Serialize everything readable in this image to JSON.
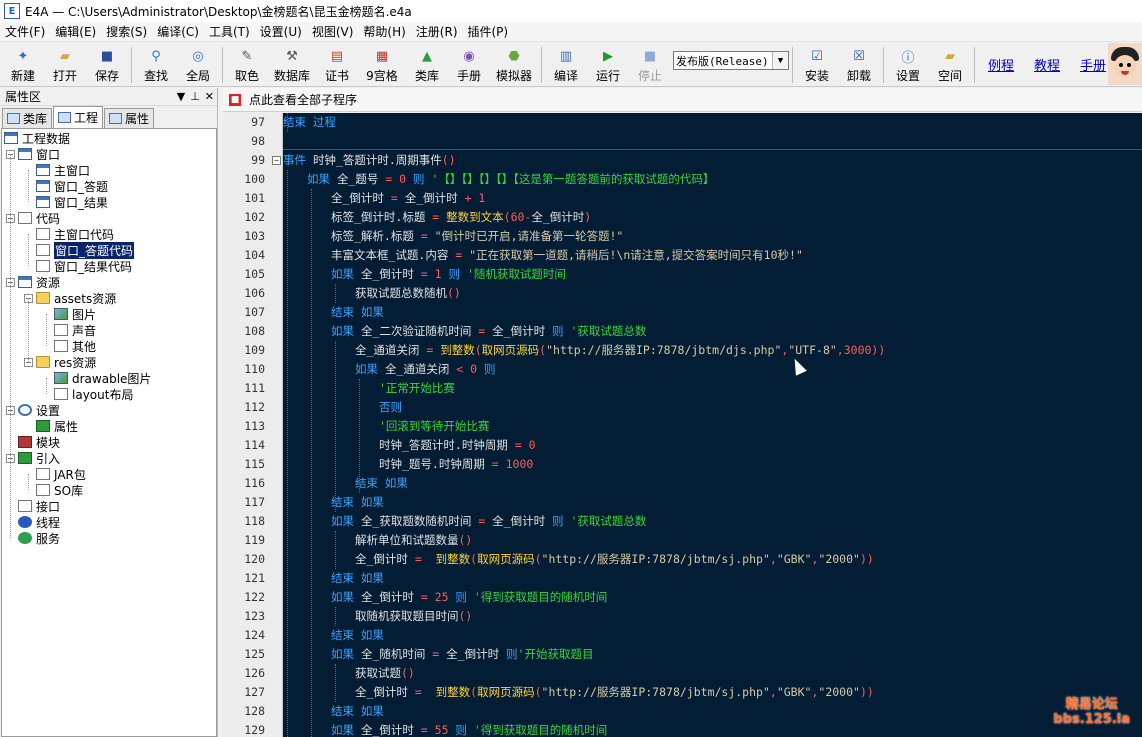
{
  "window": {
    "title": "E4A — C:\\Users\\Administrator\\Desktop\\金榜题名\\昆玉金榜题名.e4a",
    "logo": "E"
  },
  "menu": [
    "文件(F)",
    "编辑(E)",
    "搜索(S)",
    "编译(C)",
    "工具(T)",
    "设置(U)",
    "视图(V)",
    "帮助(H)",
    "注册(R)",
    "插件(P)"
  ],
  "toolbar": {
    "buttons": [
      {
        "label": "新建",
        "icon": "new-icon",
        "glyph": "✦",
        "color": "#2d6fd1"
      },
      {
        "label": "打开",
        "icon": "open-folder-icon",
        "glyph": "▰",
        "color": "#d8a63a"
      },
      {
        "label": "保存",
        "icon": "save-icon",
        "glyph": "■",
        "color": "#2a4fa0"
      },
      {
        "sep": true
      },
      {
        "label": "查找",
        "icon": "search-icon",
        "glyph": "⚲",
        "color": "#3576c8"
      },
      {
        "label": "全局",
        "icon": "global-search-icon",
        "glyph": "◎",
        "color": "#3576c8"
      },
      {
        "sep": true
      },
      {
        "label": "取色",
        "icon": "color-picker-icon",
        "glyph": "✎",
        "color": "#555"
      },
      {
        "label": "数据库",
        "icon": "database-icon",
        "glyph": "⚒",
        "color": "#555"
      },
      {
        "label": "证书",
        "icon": "certificate-icon",
        "glyph": "▤",
        "color": "#c0462a"
      },
      {
        "label": "9宫格",
        "icon": "nine-grid-icon",
        "glyph": "▦",
        "color": "#c03030"
      },
      {
        "label": "类库",
        "icon": "library-icon",
        "glyph": "▲",
        "color": "#2f9e3f"
      },
      {
        "label": "手册",
        "icon": "manual-icon",
        "glyph": "◉",
        "color": "#7a50b8"
      },
      {
        "label": "模拟器",
        "icon": "android-emulator-icon",
        "glyph": "⬣",
        "color": "#6aa83a"
      },
      {
        "sep": true
      },
      {
        "label": "编译",
        "icon": "compile-icon",
        "glyph": "▥",
        "color": "#3a6fc0"
      },
      {
        "label": "运行",
        "icon": "run-icon",
        "glyph": "▶",
        "color": "#1f9a2a"
      },
      {
        "label": "停止",
        "icon": "stop-icon",
        "glyph": "■",
        "color": "#8fa8d8",
        "disabled": true
      }
    ],
    "build_mode": "发布版(Release)",
    "buttons2": [
      {
        "label": "安装",
        "icon": "install-icon",
        "glyph": "☑",
        "color": "#2a5fb0"
      },
      {
        "label": "卸载",
        "icon": "uninstall-icon",
        "glyph": "☒",
        "color": "#2a5fb0"
      },
      {
        "sep": true
      },
      {
        "label": "设置",
        "icon": "settings-info-icon",
        "glyph": "ⓘ",
        "color": "#2a5fb0"
      },
      {
        "label": "空间",
        "icon": "space-folder-icon",
        "glyph": "▰",
        "color": "#d8a63a"
      }
    ],
    "links": [
      "例程",
      "教程",
      "手册"
    ]
  },
  "left_panel": {
    "title": "属性区",
    "controls": [
      "▼",
      "⊥",
      "✕"
    ],
    "tabs": [
      "类库",
      "工程",
      "属性"
    ],
    "active_tab": 1
  },
  "tree": [
    {
      "label": "工程数据",
      "depth": 0,
      "icon": "project-icon",
      "cls": "ic-win",
      "exp": ""
    },
    {
      "label": "窗口",
      "depth": 1,
      "icon": "window-icon",
      "cls": "ic-win",
      "exp": "−"
    },
    {
      "label": "主窗口",
      "depth": 2,
      "icon": "window-icon",
      "cls": "ic-win",
      "exp": ""
    },
    {
      "label": "窗口_答题",
      "depth": 2,
      "icon": "window-icon",
      "cls": "ic-win",
      "exp": ""
    },
    {
      "label": "窗口_结果",
      "depth": 2,
      "icon": "window-icon",
      "cls": "ic-win",
      "exp": ""
    },
    {
      "label": "代码",
      "depth": 1,
      "icon": "code-icon",
      "cls": "ic-doc",
      "exp": "−"
    },
    {
      "label": "主窗口代码",
      "depth": 2,
      "icon": "code-file-icon",
      "cls": "ic-doc",
      "exp": ""
    },
    {
      "label": "窗口_答题代码",
      "depth": 2,
      "icon": "code-file-icon",
      "cls": "ic-doc",
      "exp": "",
      "selected": true
    },
    {
      "label": "窗口_结果代码",
      "depth": 2,
      "icon": "code-file-icon",
      "cls": "ic-doc",
      "exp": ""
    },
    {
      "label": "资源",
      "depth": 1,
      "icon": "resource-icon",
      "cls": "ic-win",
      "exp": "−"
    },
    {
      "label": "assets资源",
      "depth": 2,
      "icon": "folder-icon",
      "cls": "ic-folder",
      "exp": "−"
    },
    {
      "label": "图片",
      "depth": 3,
      "icon": "image-icon",
      "cls": "ic-img",
      "exp": ""
    },
    {
      "label": "声音",
      "depth": 3,
      "icon": "music-icon",
      "cls": "ic-doc",
      "exp": ""
    },
    {
      "label": "其他",
      "depth": 3,
      "icon": "question-icon",
      "cls": "ic-doc",
      "exp": ""
    },
    {
      "label": "res资源",
      "depth": 2,
      "icon": "folder-icon",
      "cls": "ic-folder",
      "exp": "−"
    },
    {
      "label": "drawable图片",
      "depth": 3,
      "icon": "image-icon",
      "cls": "ic-img",
      "exp": ""
    },
    {
      "label": "layout布局",
      "depth": 3,
      "icon": "layout-icon",
      "cls": "ic-doc",
      "exp": ""
    },
    {
      "label": "设置",
      "depth": 1,
      "icon": "info-icon",
      "cls": "ic-gear",
      "exp": "−"
    },
    {
      "label": "属性",
      "depth": 2,
      "icon": "android-icon",
      "cls": "ic-in",
      "exp": ""
    },
    {
      "label": "模块",
      "depth": 1,
      "icon": "module-icon",
      "cls": "ic-mod",
      "exp": ""
    },
    {
      "label": "引入",
      "depth": 1,
      "icon": "import-icon",
      "cls": "ic-in",
      "exp": "−"
    },
    {
      "label": "JAR包",
      "depth": 2,
      "icon": "jar-icon",
      "cls": "ic-doc",
      "exp": ""
    },
    {
      "label": "SO库",
      "depth": 2,
      "icon": "so-icon",
      "cls": "ic-doc",
      "exp": ""
    },
    {
      "label": "接口",
      "depth": 1,
      "icon": "interface-icon",
      "cls": "ic-doc",
      "exp": ""
    },
    {
      "label": "线程",
      "depth": 1,
      "icon": "thread-icon",
      "cls": "ic-blue",
      "exp": ""
    },
    {
      "label": "服务",
      "depth": 1,
      "icon": "service-icon",
      "cls": "ic-green",
      "exp": ""
    }
  ],
  "editor": {
    "subroutine_bar": "点此查看全部子程序",
    "lines": [
      {
        "n": "97",
        "indent": 0,
        "fold": "",
        "tokens": [
          [
            "kw",
            "结束 过程"
          ]
        ]
      },
      {
        "n": "98",
        "indent": 0,
        "fold": "",
        "tokens": []
      },
      {
        "n": "99",
        "indent": 0,
        "fold": "−",
        "tokens": [
          [
            "kw",
            "事件 "
          ],
          [
            "id",
            "时钟_答题计时.周期事件"
          ],
          [
            "op",
            "()"
          ]
        ]
      },
      {
        "n": "100",
        "indent": 1,
        "fold": "",
        "tokens": [
          [
            "kw",
            "如果 "
          ],
          [
            "id",
            "全_题号 "
          ],
          [
            "op",
            "= 0 "
          ],
          [
            "kw",
            "则 "
          ],
          [
            "ct",
            "'【】【】【】【】【这是第一题答题前的获取试题的代码】"
          ]
        ]
      },
      {
        "n": "101",
        "indent": 2,
        "fold": "",
        "tokens": [
          [
            "id",
            "全_倒计时 "
          ],
          [
            "op",
            "= "
          ],
          [
            "id",
            "全_倒计时 "
          ],
          [
            "op",
            "+ 1"
          ]
        ]
      },
      {
        "n": "102",
        "indent": 2,
        "fold": "",
        "tokens": [
          [
            "id",
            "标签_倒计时.标题 "
          ],
          [
            "op",
            "= "
          ],
          [
            "fn",
            "整数到文本"
          ],
          [
            "op",
            "(60-"
          ],
          [
            "id",
            "全_倒计时"
          ],
          [
            "op",
            ")"
          ]
        ]
      },
      {
        "n": "103",
        "indent": 2,
        "fold": "",
        "tokens": [
          [
            "id",
            "标签_解析.标题 "
          ],
          [
            "op",
            "= "
          ],
          [
            "st",
            "\"倒计时已开启,请准备第一轮答题!\""
          ]
        ]
      },
      {
        "n": "104",
        "indent": 2,
        "fold": "",
        "tokens": [
          [
            "id",
            "丰富文本框_试题.内容 "
          ],
          [
            "op",
            "= "
          ],
          [
            "st",
            "\"正在获取第一道题,请稍后!\\n请注意,提交答案时间只有10秒!\""
          ]
        ]
      },
      {
        "n": "105",
        "indent": 2,
        "fold": "",
        "tokens": [
          [
            "kw",
            "如果 "
          ],
          [
            "id",
            "全_倒计时 "
          ],
          [
            "op",
            "= 1 "
          ],
          [
            "kw",
            "则 "
          ],
          [
            "ct",
            "'随机获取试题时间"
          ]
        ]
      },
      {
        "n": "106",
        "indent": 3,
        "fold": "",
        "tokens": [
          [
            "id",
            "获取试题总数随机"
          ],
          [
            "op",
            "()"
          ]
        ]
      },
      {
        "n": "107",
        "indent": 2,
        "fold": "",
        "tokens": [
          [
            "kw",
            "结束 如果"
          ]
        ]
      },
      {
        "n": "108",
        "indent": 2,
        "fold": "",
        "tokens": [
          [
            "kw",
            "如果 "
          ],
          [
            "id",
            "全_二次验证随机时间 "
          ],
          [
            "op",
            "= "
          ],
          [
            "id",
            "全_倒计时 "
          ],
          [
            "kw",
            "则 "
          ],
          [
            "ct",
            "'获取试题总数"
          ]
        ]
      },
      {
        "n": "109",
        "indent": 3,
        "fold": "",
        "tokens": [
          [
            "id",
            "全_通道关闭 "
          ],
          [
            "op",
            "= "
          ],
          [
            "fn",
            "到整数"
          ],
          [
            "op",
            "("
          ],
          [
            "fn",
            "取网页源码"
          ],
          [
            "op",
            "("
          ],
          [
            "st",
            "\"http://服务器IP:7878/jbtm/djs.php\""
          ],
          [
            "op",
            ","
          ],
          [
            "st",
            "\"UTF-8\""
          ],
          [
            "op",
            ",3000))"
          ]
        ]
      },
      {
        "n": "110",
        "indent": 3,
        "fold": "",
        "tokens": [
          [
            "kw",
            "如果 "
          ],
          [
            "id",
            "全_通道关闭 "
          ],
          [
            "op",
            "< 0 "
          ],
          [
            "kw",
            "则"
          ]
        ]
      },
      {
        "n": "111",
        "indent": 4,
        "fold": "",
        "tokens": [
          [
            "ct",
            "'正常开始比赛"
          ]
        ]
      },
      {
        "n": "112",
        "indent": 4,
        "fold": "",
        "tokens": [
          [
            "kw",
            "否则"
          ]
        ]
      },
      {
        "n": "113",
        "indent": 4,
        "fold": "",
        "tokens": [
          [
            "ct",
            "'回滚到等待开始比赛"
          ]
        ]
      },
      {
        "n": "114",
        "indent": 4,
        "fold": "",
        "tokens": [
          [
            "id",
            "时钟_答题计时.时钟周期 "
          ],
          [
            "op",
            "= 0"
          ]
        ]
      },
      {
        "n": "115",
        "indent": 4,
        "fold": "",
        "tokens": [
          [
            "id",
            "时钟_题号.时钟周期 "
          ],
          [
            "op",
            "= 1000"
          ]
        ]
      },
      {
        "n": "116",
        "indent": 3,
        "fold": "",
        "tokens": [
          [
            "kw",
            "结束 如果"
          ]
        ]
      },
      {
        "n": "117",
        "indent": 2,
        "fold": "",
        "tokens": [
          [
            "kw",
            "结束 如果"
          ]
        ]
      },
      {
        "n": "118",
        "indent": 2,
        "fold": "",
        "tokens": [
          [
            "kw",
            "如果 "
          ],
          [
            "id",
            "全_获取题数随机时间 "
          ],
          [
            "op",
            "= "
          ],
          [
            "id",
            "全_倒计时 "
          ],
          [
            "kw",
            "则 "
          ],
          [
            "ct",
            "'获取试题总数"
          ]
        ]
      },
      {
        "n": "119",
        "indent": 3,
        "fold": "",
        "tokens": [
          [
            "id",
            "解析单位和试题数量"
          ],
          [
            "op",
            "()"
          ]
        ]
      },
      {
        "n": "120",
        "indent": 3,
        "fold": "",
        "tokens": [
          [
            "id",
            "全_倒计时 "
          ],
          [
            "op",
            "=  "
          ],
          [
            "fn",
            "到整数"
          ],
          [
            "op",
            "("
          ],
          [
            "fn",
            "取网页源码"
          ],
          [
            "op",
            "("
          ],
          [
            "st",
            "\"http://服务器IP:7878/jbtm/sj.php\""
          ],
          [
            "op",
            ","
          ],
          [
            "st",
            "\"GBK\""
          ],
          [
            "op",
            ","
          ],
          [
            "st",
            "\"2000\""
          ],
          [
            "op",
            "))"
          ]
        ]
      },
      {
        "n": "121",
        "indent": 2,
        "fold": "",
        "tokens": [
          [
            "kw",
            "结束 如果"
          ]
        ]
      },
      {
        "n": "122",
        "indent": 2,
        "fold": "",
        "tokens": [
          [
            "kw",
            "如果 "
          ],
          [
            "id",
            "全_倒计时 "
          ],
          [
            "op",
            "= 25 "
          ],
          [
            "kw",
            "则 "
          ],
          [
            "ct",
            "'得到获取题目的随机时间"
          ]
        ]
      },
      {
        "n": "123",
        "indent": 3,
        "fold": "",
        "tokens": [
          [
            "id",
            "取随机获取题目时间"
          ],
          [
            "op",
            "()"
          ]
        ]
      },
      {
        "n": "124",
        "indent": 2,
        "fold": "",
        "tokens": [
          [
            "kw",
            "结束 如果"
          ]
        ]
      },
      {
        "n": "125",
        "indent": 2,
        "fold": "",
        "tokens": [
          [
            "kw",
            "如果 "
          ],
          [
            "id",
            "全_随机时间 "
          ],
          [
            "op",
            "= "
          ],
          [
            "id",
            "全_倒计时 "
          ],
          [
            "kw",
            "则"
          ],
          [
            "ct",
            "'开始获取题目"
          ]
        ]
      },
      {
        "n": "126",
        "indent": 3,
        "fold": "",
        "tokens": [
          [
            "id",
            "获取试题"
          ],
          [
            "op",
            "()"
          ]
        ]
      },
      {
        "n": "127",
        "indent": 3,
        "fold": "",
        "tokens": [
          [
            "id",
            "全_倒计时 "
          ],
          [
            "op",
            "=  "
          ],
          [
            "fn",
            "到整数"
          ],
          [
            "op",
            "("
          ],
          [
            "fn",
            "取网页源码"
          ],
          [
            "op",
            "("
          ],
          [
            "st",
            "\"http://服务器IP:7878/jbtm/sj.php\""
          ],
          [
            "op",
            ","
          ],
          [
            "st",
            "\"GBK\""
          ],
          [
            "op",
            ","
          ],
          [
            "st",
            "\"2000\""
          ],
          [
            "op",
            "))"
          ]
        ]
      },
      {
        "n": "128",
        "indent": 2,
        "fold": "",
        "tokens": [
          [
            "kw",
            "结束 如果"
          ]
        ]
      },
      {
        "n": "129",
        "indent": 2,
        "fold": "",
        "tokens": [
          [
            "kw",
            "如果 "
          ],
          [
            "id",
            "全_倒计时 "
          ],
          [
            "op",
            "= 55 "
          ],
          [
            "kw",
            "则 "
          ],
          [
            "ct",
            "'得到获取题目的随机时间"
          ]
        ]
      }
    ]
  },
  "watermark": {
    "line1": "精易论坛",
    "line2": "bbs.125.la"
  }
}
